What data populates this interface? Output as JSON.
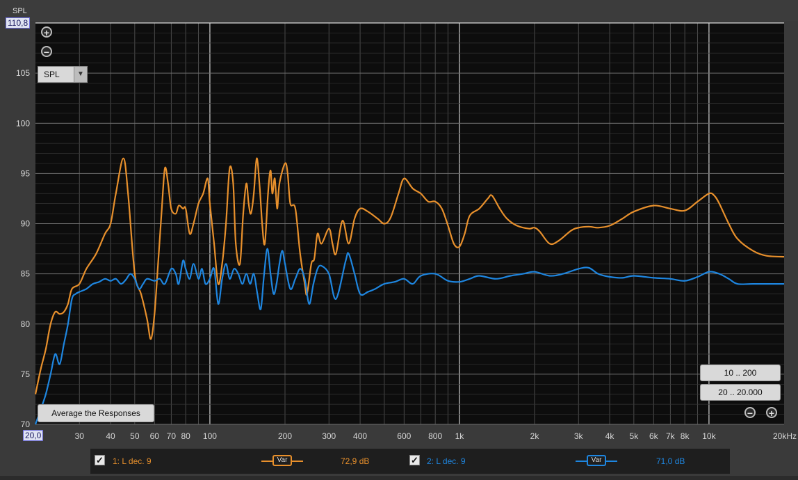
{
  "chart_data": {
    "type": "line",
    "ylabel": "SPL",
    "xunit_label": "20kHz",
    "ylim": [
      70,
      110
    ],
    "xlim": [
      20,
      20000
    ],
    "x_scale": "log",
    "grid": true,
    "y_ticks": [
      "70",
      "75",
      "80",
      "85",
      "90",
      "95",
      "100",
      "105",
      "110"
    ],
    "x_ticks": [
      {
        "v": 30,
        "t": "30"
      },
      {
        "v": 40,
        "t": "40"
      },
      {
        "v": 50,
        "t": "50"
      },
      {
        "v": 60,
        "t": "60"
      },
      {
        "v": 70,
        "t": "70"
      },
      {
        "v": 80,
        "t": "80"
      },
      {
        "v": 100,
        "t": "100"
      },
      {
        "v": 200,
        "t": "200"
      },
      {
        "v": 300,
        "t": "300"
      },
      {
        "v": 400,
        "t": "400"
      },
      {
        "v": 600,
        "t": "600"
      },
      {
        "v": 800,
        "t": "800"
      },
      {
        "v": 1000,
        "t": "1k"
      },
      {
        "v": 2000,
        "t": "2k"
      },
      {
        "v": 3000,
        "t": "3k"
      },
      {
        "v": 4000,
        "t": "4k"
      },
      {
        "v": 5000,
        "t": "5k"
      },
      {
        "v": 6000,
        "t": "6k"
      },
      {
        "v": 7000,
        "t": "7k"
      },
      {
        "v": 8000,
        "t": "8k"
      },
      {
        "v": 10000,
        "t": "10k"
      }
    ],
    "series": [
      {
        "name": "1: L dec. 9",
        "color": "#e8902c",
        "points": [
          [
            20,
            73
          ],
          [
            21,
            75.5
          ],
          [
            22,
            77.5
          ],
          [
            23,
            80
          ],
          [
            24,
            81.2
          ],
          [
            25,
            81
          ],
          [
            26,
            81.2
          ],
          [
            27,
            82
          ],
          [
            28,
            83.5
          ],
          [
            30,
            84
          ],
          [
            32,
            85.5
          ],
          [
            35,
            87
          ],
          [
            38,
            89
          ],
          [
            40,
            90
          ],
          [
            42,
            93
          ],
          [
            45,
            96.5
          ],
          [
            47,
            93
          ],
          [
            50,
            85
          ],
          [
            53,
            83
          ],
          [
            56,
            80.5
          ],
          [
            58,
            78.5
          ],
          [
            60,
            81
          ],
          [
            62,
            86
          ],
          [
            64,
            91
          ],
          [
            66,
            95.5
          ],
          [
            68,
            94
          ],
          [
            70,
            91.5
          ],
          [
            73,
            91
          ],
          [
            75,
            91.8
          ],
          [
            78,
            91.5
          ],
          [
            80,
            91.5
          ],
          [
            83,
            89
          ],
          [
            86,
            90
          ],
          [
            90,
            92
          ],
          [
            94,
            93
          ],
          [
            98,
            94.5
          ],
          [
            100,
            92
          ],
          [
            104,
            88
          ],
          [
            108,
            84
          ],
          [
            112,
            86
          ],
          [
            116,
            90
          ],
          [
            120,
            95.5
          ],
          [
            124,
            94
          ],
          [
            127,
            88
          ],
          [
            132,
            86
          ],
          [
            136,
            91
          ],
          [
            140,
            94
          ],
          [
            143,
            92
          ],
          [
            146,
            91
          ],
          [
            150,
            93
          ],
          [
            154,
            96.5
          ],
          [
            158,
            94
          ],
          [
            162,
            90
          ],
          [
            166,
            88
          ],
          [
            171,
            93
          ],
          [
            175,
            95.3
          ],
          [
            178,
            93
          ],
          [
            182,
            94.5
          ],
          [
            186,
            91.5
          ],
          [
            190,
            94
          ],
          [
            200,
            96
          ],
          [
            205,
            95
          ],
          [
            210,
            92
          ],
          [
            220,
            91.5
          ],
          [
            230,
            87
          ],
          [
            240,
            84
          ],
          [
            245,
            83
          ],
          [
            255,
            86
          ],
          [
            262,
            86.5
          ],
          [
            270,
            89
          ],
          [
            280,
            88
          ],
          [
            300,
            89.5
          ],
          [
            310,
            88
          ],
          [
            320,
            87
          ],
          [
            340,
            90.3
          ],
          [
            360,
            88
          ],
          [
            380,
            90.5
          ],
          [
            400,
            91.5
          ],
          [
            430,
            91.2
          ],
          [
            470,
            90.5
          ],
          [
            500,
            90
          ],
          [
            530,
            90.6
          ],
          [
            570,
            93
          ],
          [
            600,
            94.5
          ],
          [
            650,
            93.5
          ],
          [
            700,
            93
          ],
          [
            750,
            92.2
          ],
          [
            800,
            92.2
          ],
          [
            850,
            91.5
          ],
          [
            900,
            89.8
          ],
          [
            950,
            88
          ],
          [
            1000,
            87.7
          ],
          [
            1050,
            89
          ],
          [
            1100,
            90.8
          ],
          [
            1200,
            91.5
          ],
          [
            1300,
            92.5
          ],
          [
            1350,
            92.8
          ],
          [
            1450,
            91.5
          ],
          [
            1550,
            90.5
          ],
          [
            1700,
            89.8
          ],
          [
            1900,
            89.5
          ],
          [
            2000,
            89.6
          ],
          [
            2100,
            89.2
          ],
          [
            2300,
            88
          ],
          [
            2500,
            88.3
          ],
          [
            2800,
            89.3
          ],
          [
            3000,
            89.6
          ],
          [
            3300,
            89.7
          ],
          [
            3600,
            89.6
          ],
          [
            4000,
            89.8
          ],
          [
            4500,
            90.5
          ],
          [
            5000,
            91.2
          ],
          [
            6000,
            91.8
          ],
          [
            7000,
            91.5
          ],
          [
            8000,
            91.3
          ],
          [
            9000,
            92.2
          ],
          [
            10000,
            93
          ],
          [
            10500,
            92.8
          ],
          [
            11000,
            92
          ],
          [
            12000,
            90
          ],
          [
            13000,
            88.5
          ],
          [
            15000,
            87.3
          ],
          [
            17000,
            86.8
          ],
          [
            20000,
            86.7
          ]
        ]
      },
      {
        "name": "2: L dec. 9",
        "color": "#1e86e0",
        "points": [
          [
            20,
            70
          ],
          [
            21,
            71.5
          ],
          [
            22,
            73
          ],
          [
            23,
            75
          ],
          [
            24,
            77
          ],
          [
            25,
            76
          ],
          [
            26,
            78
          ],
          [
            27,
            80
          ],
          [
            28,
            82.5
          ],
          [
            29,
            83
          ],
          [
            30,
            83.2
          ],
          [
            32,
            83.5
          ],
          [
            34,
            84
          ],
          [
            36,
            84.2
          ],
          [
            38,
            84.5
          ],
          [
            40,
            84.3
          ],
          [
            42,
            84.5
          ],
          [
            44,
            84
          ],
          [
            46,
            84.4
          ],
          [
            48,
            85
          ],
          [
            50,
            84.5
          ],
          [
            52,
            83.5
          ],
          [
            54,
            84
          ],
          [
            56,
            84.5
          ],
          [
            60,
            84.3
          ],
          [
            63,
            84.5
          ],
          [
            66,
            84
          ],
          [
            70,
            85.5
          ],
          [
            73,
            85
          ],
          [
            75,
            84
          ],
          [
            78,
            86.3
          ],
          [
            80,
            85.5
          ],
          [
            83,
            84.5
          ],
          [
            86,
            86
          ],
          [
            90,
            84.5
          ],
          [
            93,
            85.5
          ],
          [
            96,
            84
          ],
          [
            100,
            84.5
          ],
          [
            104,
            85.5
          ],
          [
            108,
            82
          ],
          [
            112,
            84.5
          ],
          [
            116,
            86
          ],
          [
            120,
            84.5
          ],
          [
            125,
            85.5
          ],
          [
            130,
            85
          ],
          [
            135,
            84
          ],
          [
            140,
            85
          ],
          [
            145,
            84
          ],
          [
            150,
            85
          ],
          [
            155,
            83
          ],
          [
            160,
            81.5
          ],
          [
            165,
            85
          ],
          [
            170,
            87.5
          ],
          [
            175,
            85
          ],
          [
            180,
            83
          ],
          [
            185,
            84
          ],
          [
            190,
            86
          ],
          [
            195,
            87.3
          ],
          [
            200,
            86
          ],
          [
            210,
            83.5
          ],
          [
            220,
            84.5
          ],
          [
            230,
            85.5
          ],
          [
            240,
            84.5
          ],
          [
            250,
            82
          ],
          [
            260,
            84
          ],
          [
            270,
            85.5
          ],
          [
            280,
            85.8
          ],
          [
            300,
            85
          ],
          [
            320,
            82.5
          ],
          [
            350,
            86.3
          ],
          [
            360,
            87
          ],
          [
            380,
            85
          ],
          [
            400,
            83
          ],
          [
            430,
            83.2
          ],
          [
            460,
            83.5
          ],
          [
            500,
            84
          ],
          [
            550,
            84.2
          ],
          [
            600,
            84.5
          ],
          [
            650,
            84
          ],
          [
            700,
            84.8
          ],
          [
            800,
            85
          ],
          [
            900,
            84.3
          ],
          [
            1000,
            84.2
          ],
          [
            1100,
            84.5
          ],
          [
            1200,
            84.8
          ],
          [
            1400,
            84.5
          ],
          [
            1600,
            84.8
          ],
          [
            1800,
            85
          ],
          [
            2000,
            85.2
          ],
          [
            2300,
            84.8
          ],
          [
            2600,
            85
          ],
          [
            3000,
            85.5
          ],
          [
            3300,
            85.6
          ],
          [
            3600,
            85
          ],
          [
            4000,
            84.7
          ],
          [
            4500,
            84.6
          ],
          [
            5000,
            84.8
          ],
          [
            6000,
            84.6
          ],
          [
            7000,
            84.5
          ],
          [
            8000,
            84.3
          ],
          [
            9000,
            84.7
          ],
          [
            10000,
            85.2
          ],
          [
            11000,
            85
          ],
          [
            12000,
            84.5
          ],
          [
            13000,
            84
          ],
          [
            15000,
            84
          ],
          [
            20000,
            84
          ]
        ]
      }
    ]
  },
  "cursor_readout": {
    "y": "110,8",
    "x": "20,0"
  },
  "spl_select": {
    "value": "SPL"
  },
  "average_button": "Average the Responses",
  "range_buttons": [
    "10 .. 200",
    "20 .. 20.000"
  ],
  "zoom": {
    "in": "+",
    "out": "−"
  },
  "legend": [
    {
      "checked": true,
      "label": "1: L dec. 9",
      "var": "Var",
      "value": "72,9 dB",
      "color": "#e8902c"
    },
    {
      "checked": true,
      "label": "2: L dec. 9",
      "var": "Var",
      "value": "71,0 dB",
      "color": "#1e86e0"
    }
  ]
}
